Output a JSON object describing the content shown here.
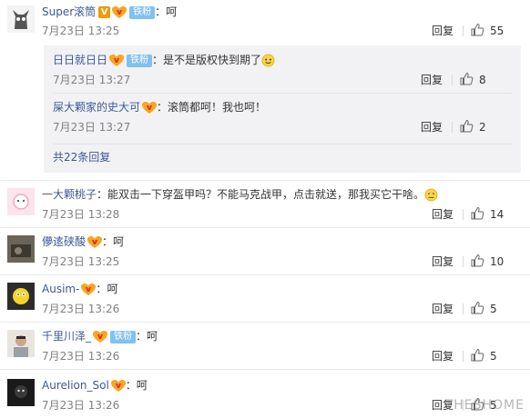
{
  "actions_reply_label": "回复",
  "comments": [
    {
      "name": "Super滚筒",
      "colon": "：",
      "text": "呵",
      "time": "7月23日 13:25",
      "likes": "55",
      "fan_badge": "铁粉"
    },
    {
      "name": "一大颗桃子",
      "colon": "：",
      "text": "能双击一下穿盔甲吗？不能马克战甲，点击就送，那我买它干啥。",
      "time": "7月23日 13:28",
      "likes": "14"
    },
    {
      "name": "儚逺硖酸",
      "colon": "：",
      "text": "呵",
      "time": "7月23日 13:25",
      "likes": "10"
    },
    {
      "name": "Ausim-",
      "colon": "：",
      "text": "呵",
      "time": "7月23日 13:26",
      "likes": "5"
    },
    {
      "name": "千里川泽_",
      "colon": "：",
      "text": "呵",
      "time": "7月23日 13:26",
      "likes": "5",
      "fan_badge": "铁粉"
    },
    {
      "name": "Aurelion_Sol",
      "colon": "：",
      "text": "呵",
      "time": "7月23日 13:26",
      "likes": "5"
    }
  ],
  "sub_replies": [
    {
      "name": "日日就日日",
      "colon": "：",
      "text": "是不是版权快到期了",
      "time": "7月23日 13:27",
      "likes": "8",
      "fan_badge": "铁粉"
    },
    {
      "name": "屎大颗家的史大可",
      "colon": "：",
      "text": "滚筒都呵！我也呵！",
      "time": "7月23日 13:27",
      "likes": "2"
    }
  ],
  "more_replies": "共22条回复",
  "watermark": "THESHOME",
  "colors": {
    "name": "#3b5998",
    "fan_badge": "#80c1f0",
    "v_badge": "#f39800",
    "meta": "#808080"
  }
}
